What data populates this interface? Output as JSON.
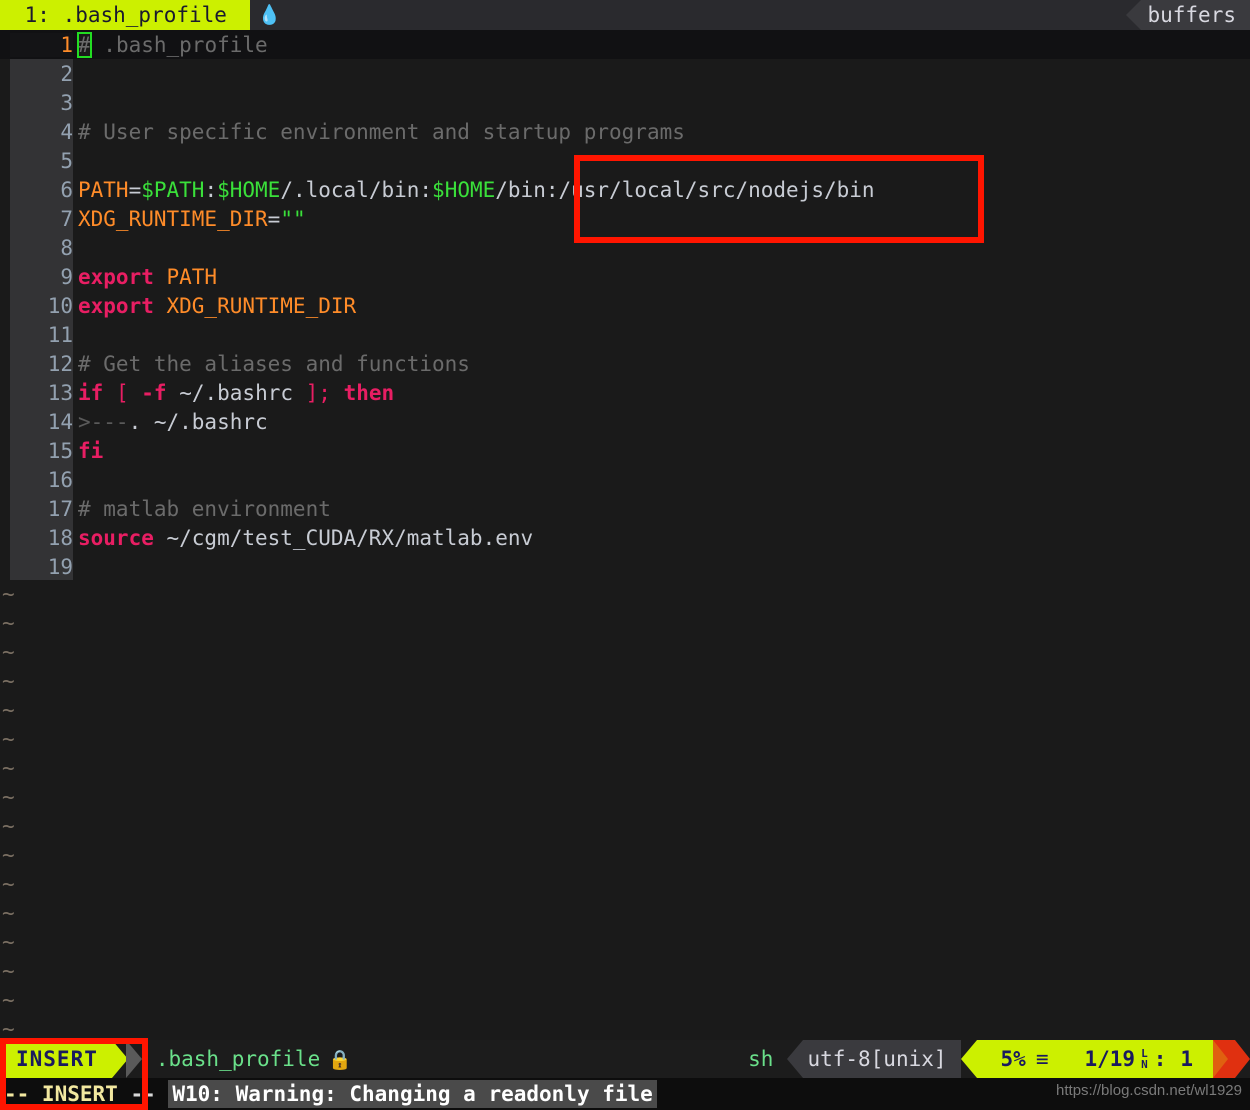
{
  "window": {
    "app": "vim",
    "theme_bg": "#1a1a1a",
    "accent": "#ccf000",
    "annotation_color": "#ff1500"
  },
  "tabline": {
    "tab_label": " 1: .bash_profile ",
    "modified_icon": "flame-icon",
    "modified_glyph": "●",
    "buffers_label": "buffers"
  },
  "editor": {
    "lines": [
      {
        "num": "1",
        "cursor": true,
        "segments": [
          {
            "t": "#",
            "c": "cursor-char"
          },
          {
            "t": " .bash_profile",
            "c": "c-comment"
          }
        ]
      },
      {
        "num": "2",
        "cursor": false,
        "segments": []
      },
      {
        "num": "3",
        "cursor": false,
        "segments": []
      },
      {
        "num": "4",
        "cursor": false,
        "segments": [
          {
            "t": "# User specific environment and startup programs",
            "c": "c-comment"
          }
        ]
      },
      {
        "num": "5",
        "cursor": false,
        "segments": []
      },
      {
        "num": "6",
        "cursor": false,
        "segments": [
          {
            "t": "PATH",
            "c": "c-var"
          },
          {
            "t": "=",
            "c": "c-plain"
          },
          {
            "t": "$PATH",
            "c": "c-expand"
          },
          {
            "t": ":",
            "c": "c-plain"
          },
          {
            "t": "$HOME",
            "c": "c-expand"
          },
          {
            "t": "/.local/bin:",
            "c": "c-plain"
          },
          {
            "t": "$HOME",
            "c": "c-expand"
          },
          {
            "t": "/bin:/usr/local/src/nodejs/bin",
            "c": "c-plain"
          }
        ]
      },
      {
        "num": "7",
        "cursor": false,
        "segments": [
          {
            "t": "XDG_RUNTIME_DIR",
            "c": "c-var"
          },
          {
            "t": "=",
            "c": "c-plain"
          },
          {
            "t": "\"\"",
            "c": "c-str"
          }
        ]
      },
      {
        "num": "8",
        "cursor": false,
        "segments": []
      },
      {
        "num": "9",
        "cursor": false,
        "segments": [
          {
            "t": "export",
            "c": "c-kw"
          },
          {
            "t": " PATH",
            "c": "c-var"
          }
        ]
      },
      {
        "num": "10",
        "cursor": false,
        "segments": [
          {
            "t": "export",
            "c": "c-kw"
          },
          {
            "t": " XDG_RUNTIME_DIR",
            "c": "c-var"
          }
        ]
      },
      {
        "num": "11",
        "cursor": false,
        "segments": []
      },
      {
        "num": "12",
        "cursor": false,
        "segments": [
          {
            "t": "# Get the aliases and functions",
            "c": "c-comment"
          }
        ]
      },
      {
        "num": "13",
        "cursor": false,
        "segments": [
          {
            "t": "if",
            "c": "c-kw"
          },
          {
            "t": " ",
            "c": "c-plain"
          },
          {
            "t": "[",
            "c": "c-op"
          },
          {
            "t": " ",
            "c": "c-plain"
          },
          {
            "t": "-f",
            "c": "c-kw"
          },
          {
            "t": " ~/.bashrc ",
            "c": "c-plain"
          },
          {
            "t": "];",
            "c": "c-op"
          },
          {
            "t": " ",
            "c": "c-plain"
          },
          {
            "t": "then",
            "c": "c-kw"
          }
        ]
      },
      {
        "num": "14",
        "cursor": false,
        "segments": [
          {
            "t": ">---",
            "c": "c-tab"
          },
          {
            "t": ". ~/.bashrc",
            "c": "c-plain"
          }
        ]
      },
      {
        "num": "15",
        "cursor": false,
        "segments": [
          {
            "t": "fi",
            "c": "c-kw"
          }
        ]
      },
      {
        "num": "16",
        "cursor": false,
        "segments": []
      },
      {
        "num": "17",
        "cursor": false,
        "segments": [
          {
            "t": "# matlab environment",
            "c": "c-comment"
          }
        ]
      },
      {
        "num": "18",
        "cursor": false,
        "segments": [
          {
            "t": "source",
            "c": "c-kw"
          },
          {
            "t": " ~/cgm/test_CUDA/RX/matlab.env",
            "c": "c-plain"
          }
        ]
      },
      {
        "num": "19",
        "cursor": false,
        "segments": []
      }
    ],
    "empty_marker": "~",
    "empty_marker_count": 16
  },
  "statusline": {
    "mode": "INSERT",
    "filename": ".bash_profile",
    "readonly_icon": "lock-icon",
    "readonly_glyph": "🔒",
    "filetype": "sh",
    "encoding": "utf-8[unix]",
    "percent": "5%",
    "percent_glyph": "≡",
    "position": "1/19",
    "line_col_glyph_top": "L",
    "line_col_glyph_bottom": "N",
    "col_separator": ":",
    "column": "1"
  },
  "messageline": {
    "mode_text": "-- INSERT ",
    "dash_text": "-- ",
    "warning": "W10: Warning: Changing a readonly file"
  },
  "watermark": {
    "text": "https://blog.csdn.net/wl1929"
  },
  "annotations": {
    "path_box_target": ":/usr/local/src/nodejs/bin",
    "insert_box_target": "INSERT"
  }
}
